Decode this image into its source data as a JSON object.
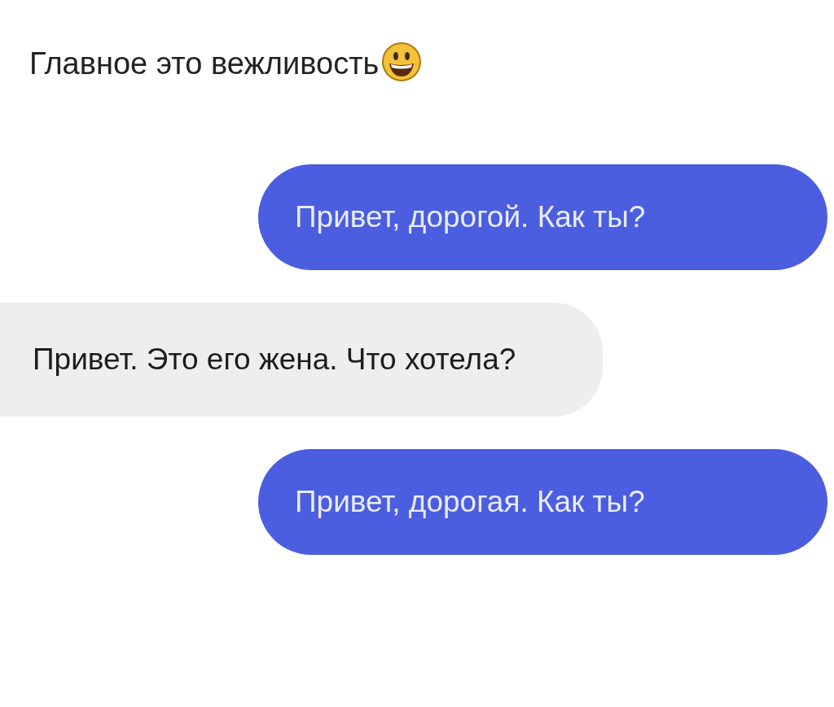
{
  "title": "Главное это вежливость",
  "messages": [
    {
      "kind": "sent",
      "text": "Привет, дорогой. Как ты?"
    },
    {
      "kind": "received",
      "text": "Привет. Это его жена. Что хотела?"
    },
    {
      "kind": "sent",
      "text": "Привет, дорогая. Как ты?"
    }
  ]
}
